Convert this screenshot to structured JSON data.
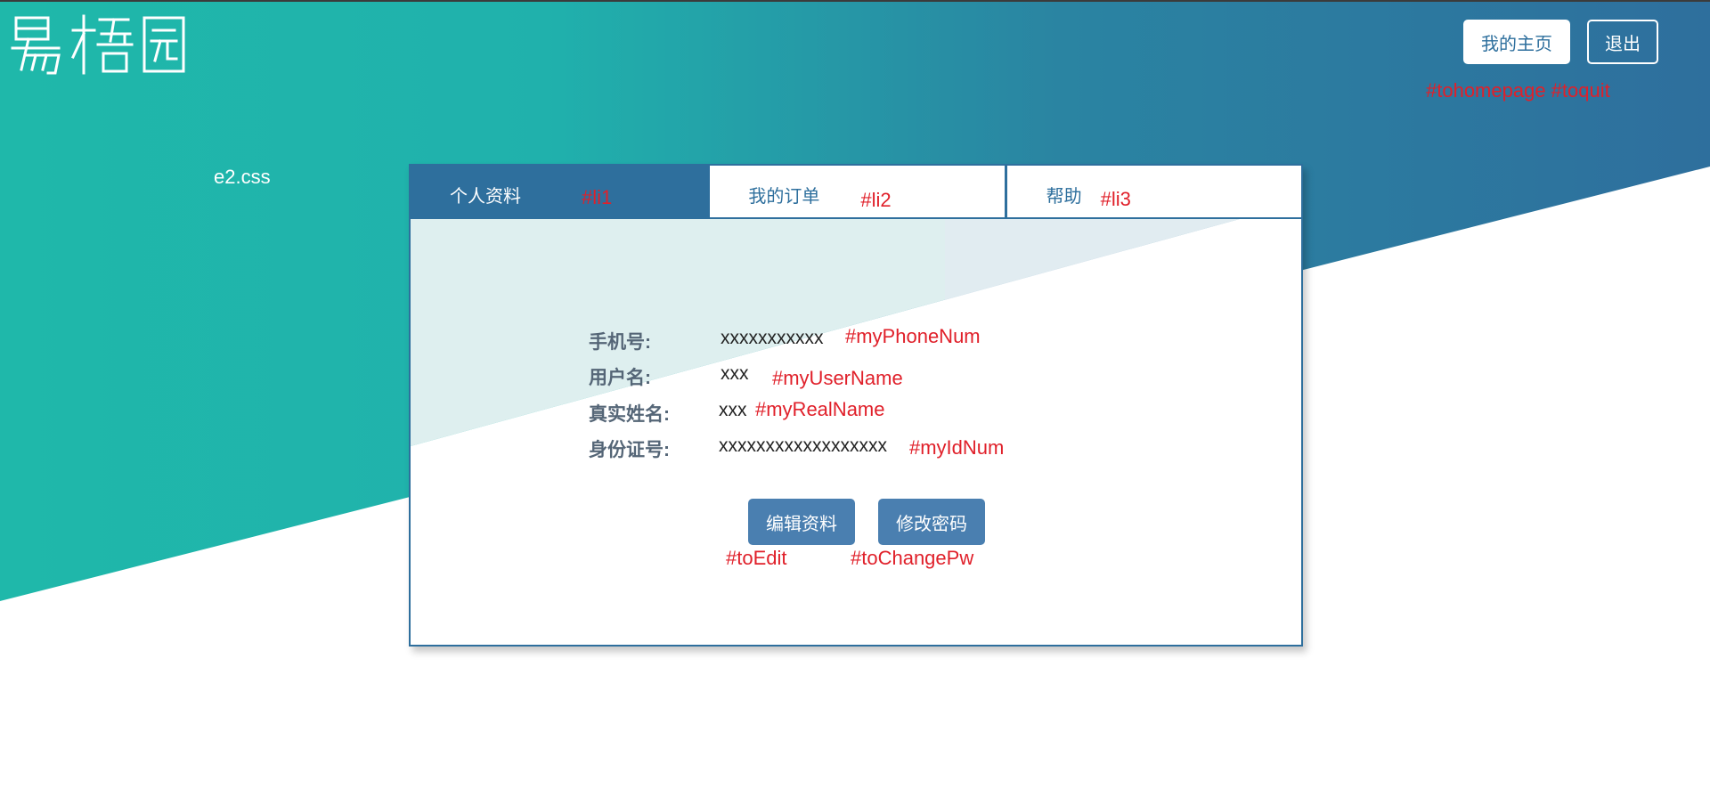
{
  "header": {
    "logo_text": "易梧园",
    "homepage_button": "我的主页",
    "quit_button": "退出",
    "annotation": "#tohomepage #toquit"
  },
  "stylesheet_note": "e2.css",
  "tabs": [
    {
      "label": "个人资料",
      "annotation": "#li1",
      "active": true
    },
    {
      "label": "我的订单",
      "annotation": "#li2",
      "active": false
    },
    {
      "label": "帮助",
      "annotation": "#li3",
      "active": false
    }
  ],
  "profile": {
    "phone": {
      "label": "手机号:",
      "value": "xxxxxxxxxxx",
      "annotation": "#myPhoneNum"
    },
    "username": {
      "label": "用户名:",
      "value": "xxx",
      "annotation": "#myUserName"
    },
    "realname": {
      "label": "真实姓名:",
      "value": "xxx",
      "annotation": "#myRealName"
    },
    "idnum": {
      "label": "身份证号:",
      "value": "xxxxxxxxxxxxxxxxxx",
      "annotation": "#myIdNum"
    }
  },
  "actions": {
    "edit_button": "编辑资料",
    "edit_annotation": "#toEdit",
    "change_pw_button": "修改密码",
    "change_pw_annotation": "#toChangePw"
  },
  "colors": {
    "gradient_start": "#1fb8aa",
    "gradient_end": "#2e6f9d",
    "accent": "#2e6f9d",
    "annotation": "#e0202a"
  }
}
